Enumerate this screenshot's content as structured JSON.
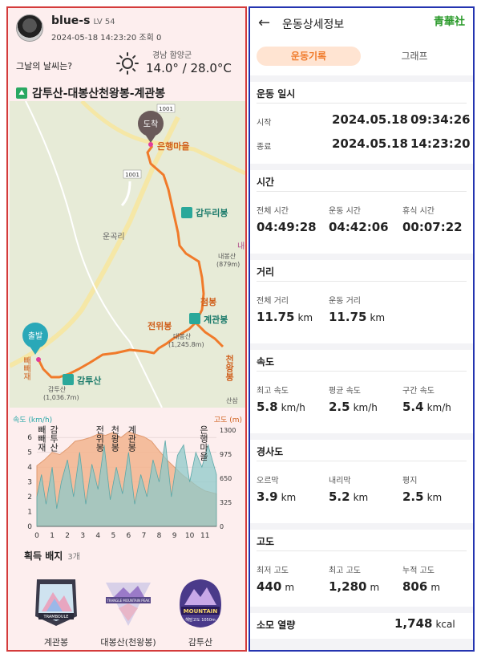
{
  "profile": {
    "username": "blue-s",
    "level": "LV 54",
    "meta": "2024-05-18 14:23:20 조회 0"
  },
  "weather": {
    "question": "그날의 날씨는?",
    "region": "경남 함양군",
    "temp": "14.0° / 28.0°C",
    "icon": "sun-icon"
  },
  "route_title": "감투산-대봉산천왕봉-계관봉",
  "map": {
    "start_label": "출발",
    "end_label": "도착",
    "road_labels": [
      "1001",
      "1001"
    ],
    "places": [
      "은행마을",
      "갑두리봉",
      "내종",
      "내봉산",
      "(879m)",
      "운곡리",
      "첨봉",
      "계관봉",
      "전위봉",
      "대봉산",
      "(1,245.8m)",
      "천왕봉",
      "빼빼재",
      "감투산",
      "감투산",
      "(1,036.7m)",
      "산삼"
    ]
  },
  "chart_data": {
    "type": "area",
    "title": "",
    "xlabel": "",
    "left_axis_label": "속도 (km/h)",
    "right_axis_label": "고도 (m)",
    "x_ticks": [
      0,
      1,
      2,
      3,
      4,
      5,
      6,
      7,
      8,
      9,
      10,
      11
    ],
    "speed_ticks": [
      0,
      1,
      2,
      3,
      4,
      5,
      6
    ],
    "altitude_ticks": [
      0,
      325,
      650,
      975,
      1300
    ],
    "xlim": [
      0,
      11.75
    ],
    "speed_ylim": [
      0,
      6.5
    ],
    "alt_ylim": [
      0,
      1300
    ],
    "point_labels": [
      {
        "x": 0.2,
        "text": "빼빼재"
      },
      {
        "x": 1.0,
        "text": "감투산"
      },
      {
        "x": 4.0,
        "text": "전위봉"
      },
      {
        "x": 5.0,
        "text": "천왕봉"
      },
      {
        "x": 6.1,
        "text": "계관봉"
      },
      {
        "x": 10.8,
        "text": "은행마을"
      }
    ],
    "series": [
      {
        "name": "고도",
        "x": [
          0,
          0.5,
          1.0,
          1.5,
          2.0,
          2.5,
          3.0,
          3.5,
          4.0,
          4.5,
          5.0,
          5.5,
          6.0,
          6.5,
          7.0,
          7.5,
          8.0,
          8.5,
          9.0,
          9.5,
          10.0,
          10.5,
          11.0,
          11.75
        ],
        "values": [
          820,
          900,
          1000,
          970,
          1050,
          1150,
          1170,
          1200,
          1245,
          1230,
          1270,
          1200,
          1280,
          1240,
          1210,
          1150,
          1020,
          900,
          800,
          700,
          620,
          540,
          480,
          440
        ]
      },
      {
        "name": "속도",
        "x": [
          0,
          0.3,
          0.6,
          1.0,
          1.3,
          1.6,
          2.0,
          2.4,
          2.8,
          3.2,
          3.6,
          4.0,
          4.4,
          4.8,
          5.2,
          5.6,
          6.0,
          6.4,
          6.8,
          7.2,
          7.6,
          8.0,
          8.4,
          8.8,
          9.2,
          9.6,
          10.0,
          10.4,
          10.8,
          11.2,
          11.75
        ],
        "values": [
          2.0,
          3.5,
          1.5,
          4.0,
          1.2,
          3.0,
          4.5,
          2.0,
          5.0,
          1.5,
          4.2,
          2.5,
          5.5,
          1.8,
          4.0,
          2.2,
          5.0,
          1.5,
          3.5,
          2.0,
          4.5,
          3.0,
          5.8,
          2.0,
          4.8,
          5.5,
          3.0,
          5.0,
          4.0,
          5.5,
          3.5
        ]
      }
    ]
  },
  "badges": {
    "title": "획득 배지",
    "count": "3개",
    "items": [
      {
        "label": "계관봉",
        "art_text": "TRAMBOULE"
      },
      {
        "label": "대봉산(천왕봉)",
        "art_text": "TRANGLE MOUNTAIN PEAK"
      },
      {
        "label": "감투산",
        "art_text": "MOUNTAIN",
        "art_sub": "해발고도 1050m"
      }
    ]
  },
  "detail": {
    "back_glyph": "←",
    "title": "운동상세정보",
    "stamp": "青華社",
    "tabs": [
      "운동기록",
      "그래프"
    ],
    "time_section": {
      "title": "운동 일시",
      "start_label": "시작",
      "start_date": "2024.05.18",
      "start_time": "09:34:26",
      "end_label": "종료",
      "end_date": "2024.05.18",
      "end_time": "14:23:20"
    },
    "duration": {
      "title": "시간",
      "items": [
        {
          "label": "전체 시간",
          "value": "04:49:28"
        },
        {
          "label": "운동 시간",
          "value": "04:42:06"
        },
        {
          "label": "휴식 시간",
          "value": "00:07:22"
        }
      ]
    },
    "distance": {
      "title": "거리",
      "items": [
        {
          "label": "전체 거리",
          "value": "11.75",
          "unit": "km"
        },
        {
          "label": "운동 거리",
          "value": "11.75",
          "unit": "km"
        }
      ]
    },
    "speed": {
      "title": "속도",
      "items": [
        {
          "label": "최고 속도",
          "value": "5.8",
          "unit": "km/h"
        },
        {
          "label": "평균 속도",
          "value": "2.5",
          "unit": "km/h"
        },
        {
          "label": "구간 속도",
          "value": "5.4",
          "unit": "km/h"
        }
      ]
    },
    "slope": {
      "title": "경사도",
      "items": [
        {
          "label": "오르막",
          "value": "3.9",
          "unit": "km"
        },
        {
          "label": "내리막",
          "value": "5.2",
          "unit": "km"
        },
        {
          "label": "평지",
          "value": "2.5",
          "unit": "km"
        }
      ]
    },
    "altitude": {
      "title": "고도",
      "items": [
        {
          "label": "최저 고도",
          "value": "440",
          "unit": "m"
        },
        {
          "label": "최고 고도",
          "value": "1,280",
          "unit": "m"
        },
        {
          "label": "누적 고도",
          "value": "806",
          "unit": "m"
        }
      ]
    },
    "calories": {
      "label": "소모 열량",
      "value": "1,748",
      "unit": "kcal"
    }
  },
  "colors": {
    "left_border": "#d43b3b",
    "right_border": "#2434b0",
    "route": "#f07a2a",
    "altitude_fill": "#f2b48e",
    "speed_fill": "#8ec9c9",
    "accent_tab": "#f07a2a",
    "stamp": "#2a9a2a"
  }
}
